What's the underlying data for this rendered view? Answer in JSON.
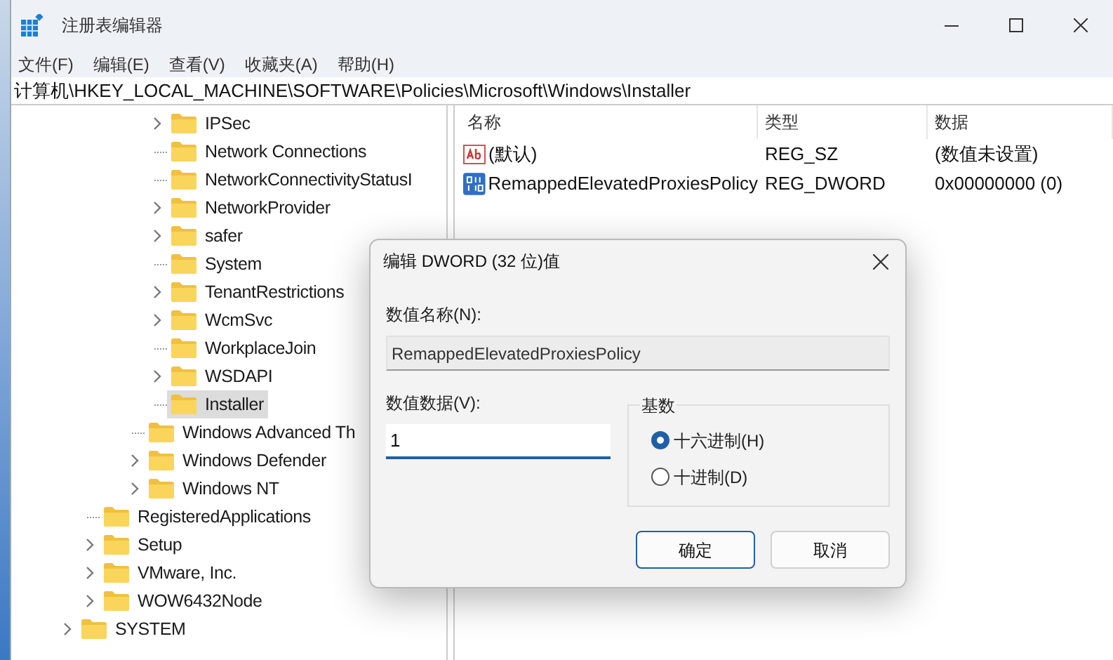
{
  "window": {
    "title": "注册表编辑器"
  },
  "menu": [
    "文件(F)",
    "编辑(E)",
    "查看(V)",
    "收藏夹(A)",
    "帮助(H)"
  ],
  "address": "计算机\\HKEY_LOCAL_MACHINE\\SOFTWARE\\Policies\\Microsoft\\Windows\\Installer",
  "tree": [
    {
      "children": [
        {
          "children": [
            {
              "children": [
                {
                  "children": [
                    {
                      "children": [
                        {
                          "label": "IPSec",
                          "has_children": true,
                          "selected": false
                        },
                        {
                          "label": "Network Connections",
                          "has_children": false,
                          "selected": false
                        },
                        {
                          "label": "NetworkConnectivityStatusI",
                          "has_children": false,
                          "selected": false
                        },
                        {
                          "label": "NetworkProvider",
                          "has_children": true,
                          "selected": false
                        },
                        {
                          "label": "safer",
                          "has_children": true,
                          "selected": false
                        },
                        {
                          "label": "System",
                          "has_children": false,
                          "selected": false
                        },
                        {
                          "label": "TenantRestrictions",
                          "has_children": true,
                          "selected": false
                        },
                        {
                          "label": "WcmSvc",
                          "has_children": true,
                          "selected": false
                        },
                        {
                          "label": "WorkplaceJoin",
                          "has_children": false,
                          "selected": false
                        },
                        {
                          "label": "WSDAPI",
                          "has_children": true,
                          "selected": false
                        },
                        {
                          "label": "Installer",
                          "has_children": false,
                          "selected": true
                        }
                      ]
                    },
                    {
                      "label": "Windows Advanced Th",
                      "has_children": false,
                      "selected": false
                    },
                    {
                      "label": "Windows Defender",
                      "has_children": true,
                      "selected": false
                    },
                    {
                      "label": "Windows NT",
                      "has_children": true,
                      "selected": false
                    }
                  ]
                }
              ]
            },
            {
              "label": "RegisteredApplications",
              "has_children": false,
              "selected": false
            },
            {
              "label": "Setup",
              "has_children": true,
              "selected": false
            },
            {
              "label": "VMware, Inc.",
              "has_children": true,
              "selected": false
            },
            {
              "label": "WOW6432Node",
              "has_children": true,
              "selected": false
            }
          ]
        },
        {
          "label": "SYSTEM",
          "has_children": true,
          "selected": false
        }
      ]
    }
  ],
  "values_table": {
    "columns": [
      "名称",
      "类型",
      "数据"
    ],
    "rows": [
      {
        "kind": "string",
        "name": "(默认)",
        "type": "REG_SZ",
        "data": "(数值未设置)"
      },
      {
        "kind": "binary",
        "name": "RemappedElevatedProxiesPolicy",
        "type": "REG_DWORD",
        "data": "0x00000000 (0)"
      }
    ]
  },
  "dialog": {
    "title": "编辑 DWORD (32 位)值",
    "name_label": "数值名称(N):",
    "name_value": "RemappedElevatedProxiesPolicy",
    "data_label": "数值数据(V):",
    "data_value": "1",
    "base_label": "基数",
    "bases": [
      {
        "label": "十六进制(H)",
        "selected": true
      },
      {
        "label": "十进制(D)",
        "selected": false
      }
    ],
    "buttons": [
      {
        "label": "确定",
        "primary": true
      },
      {
        "label": "取消",
        "primary": false
      }
    ]
  }
}
